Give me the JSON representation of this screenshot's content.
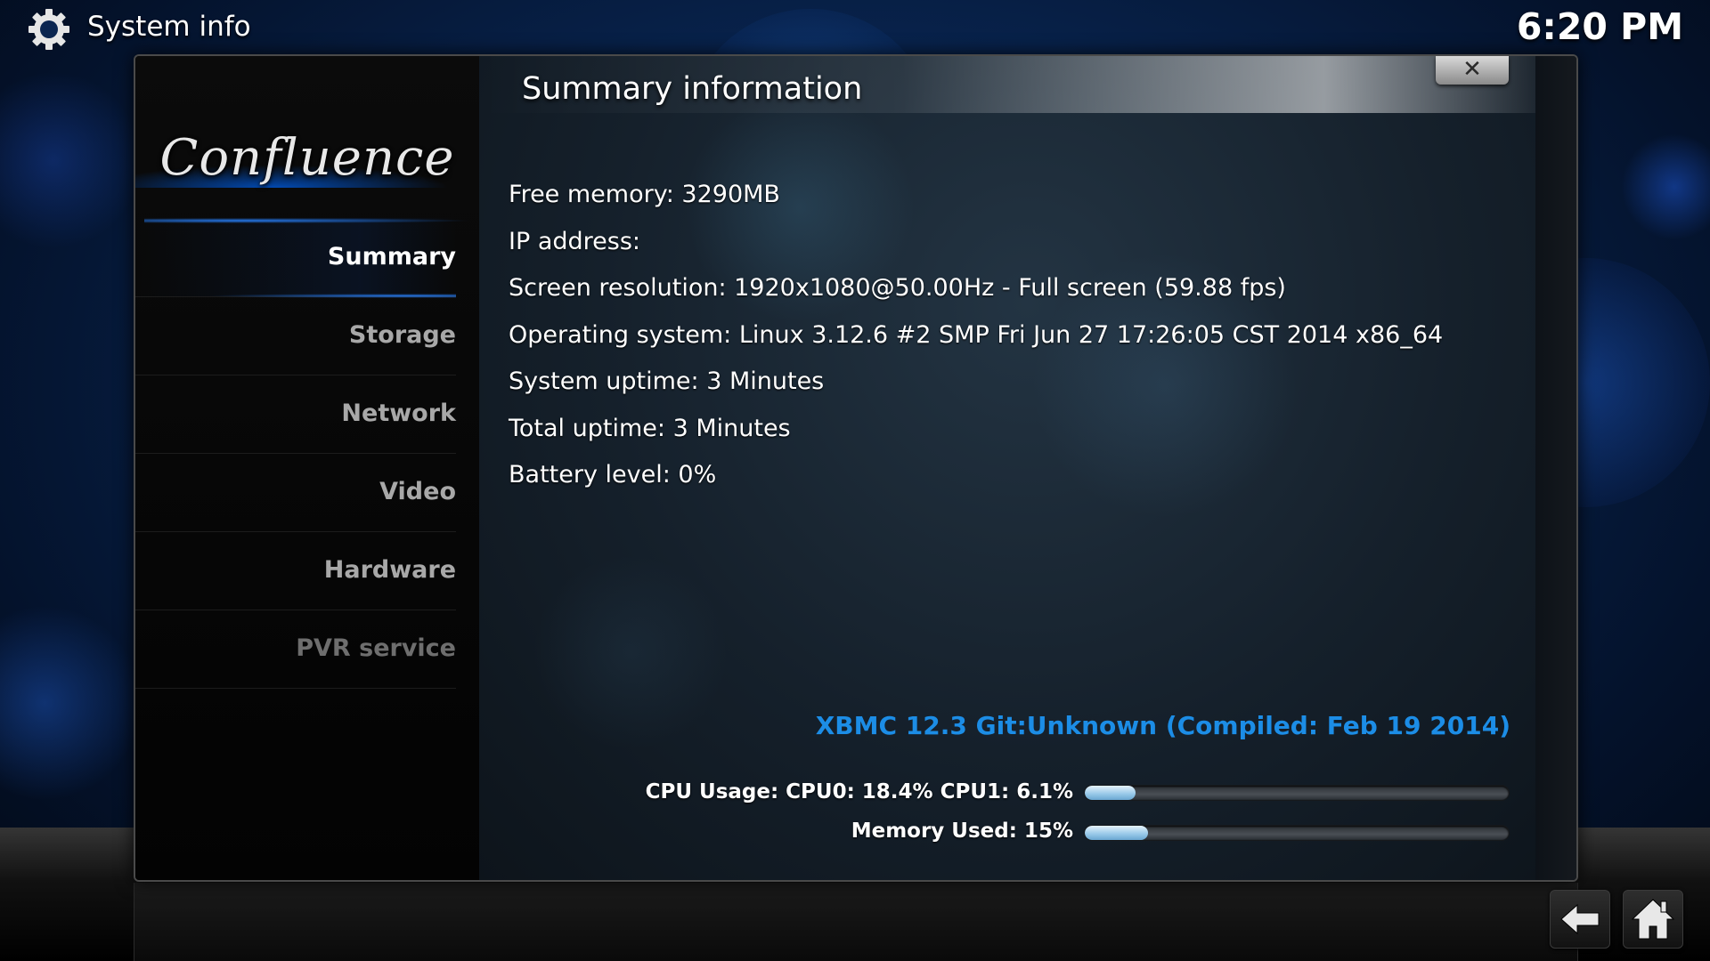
{
  "header": {
    "title": "System info",
    "clock": "6:20 PM",
    "icon": "gear-icon"
  },
  "sidebar": {
    "logo": "Confluence",
    "items": [
      {
        "label": "Summary",
        "active": true
      },
      {
        "label": "Storage"
      },
      {
        "label": "Network"
      },
      {
        "label": "Video"
      },
      {
        "label": "Hardware"
      },
      {
        "label": "PVR service",
        "disabled": true
      }
    ]
  },
  "dialog": {
    "title": "Summary information",
    "close_icon": "close-icon"
  },
  "info": [
    "Free memory: 3290MB",
    "IP address:",
    "Screen resolution: 1920x1080@50.00Hz - Full screen (59.88 fps)",
    "Operating system: Linux 3.12.6 #2 SMP Fri Jun 27 17:26:05 CST 2014 x86_64",
    "System uptime: 3 Minutes",
    "Total uptime: 3 Minutes",
    "Battery level: 0%"
  ],
  "version": "XBMC 12.3 Git:Unknown (Compiled: Feb 19 2014)",
  "usage": {
    "cpu_label": "CPU Usage: CPU0: 18.4% CPU1: 6.1%",
    "cpu_fill_percent": 12,
    "memory_label": "Memory Used: 15%",
    "memory_fill_percent": 15
  },
  "colors": {
    "accent": "#1c8de6",
    "background": "#08234d"
  },
  "nav": {
    "back_icon": "back-arrow-icon",
    "home_icon": "home-icon"
  }
}
